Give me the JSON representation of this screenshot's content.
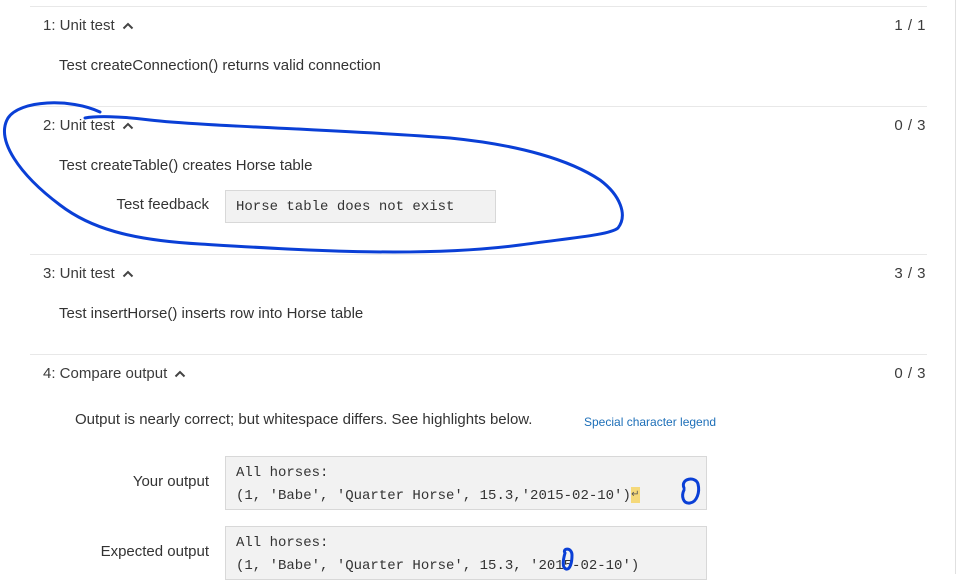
{
  "tests": [
    {
      "title": "1: Unit test",
      "score": "1 / 1",
      "description": "Test createConnection() returns valid connection"
    },
    {
      "title": "2: Unit test",
      "score": "0 / 3",
      "description": "Test createTable() creates Horse table",
      "feedback_label": "Test feedback",
      "feedback_value": "Horse table does not exist"
    },
    {
      "title": "3: Unit test",
      "score": "3 / 3",
      "description": "Test insertHorse() inserts row into Horse table"
    },
    {
      "title": "4: Compare output",
      "score": "0 / 3",
      "message": "Output is nearly correct; but whitespace differs. See highlights below.",
      "legend_link": "Special character legend",
      "your_output_label": "Your output",
      "your_output_lines": [
        "All horses:",
        "(1, 'Babe', 'Quarter Horse', 15.3,'2015-02-10')"
      ],
      "your_output_marker": "↵",
      "expected_output_label": "Expected output",
      "expected_output_lines": [
        "All horses:",
        "(1, 'Babe', 'Quarter Horse', 15.3, '2015-02-10')"
      ]
    }
  ],
  "colors": {
    "annotation": "#0a3fd6",
    "whitespace_highlight": "#f5d97a",
    "link": "#1d6fb8"
  }
}
